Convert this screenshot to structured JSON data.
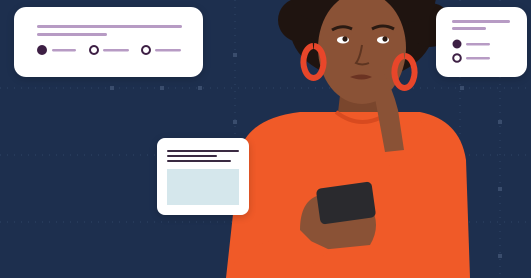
{
  "colors": {
    "background": "#1d2f4e",
    "grid_dot": "#3a4d6d",
    "card": "#ffffff",
    "bar_purple": "#b79bc4",
    "bar_dark": "#3a2a42",
    "radio_dark": "#3d1f44",
    "text_block_fill": "#d5e7ec",
    "sweater": "#f05a28",
    "skin": "#8a5236",
    "hair": "#1f1410",
    "earring": "#e8462a",
    "phone": "#2a2a2e"
  },
  "icons": {
    "radio_filled": "radio-filled-icon",
    "radio_empty": "radio-empty-icon",
    "text_placeholder": "text-lines-icon"
  },
  "cards": {
    "left_options": {
      "radios": [
        "filled",
        "empty",
        "empty"
      ]
    },
    "right_options": {
      "radios": [
        "filled",
        "empty"
      ]
    }
  }
}
